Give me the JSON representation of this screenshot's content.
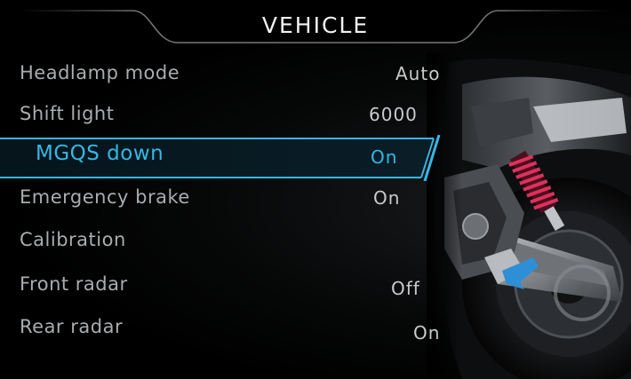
{
  "header": {
    "title": "VEHICLE"
  },
  "menu": {
    "items": [
      {
        "label": "Headlamp mode",
        "value": "Auto"
      },
      {
        "label": "Shift light",
        "value": "6000"
      },
      {
        "label": "MGQS down",
        "value": "On",
        "selected": true
      },
      {
        "label": "Emergency brake",
        "value": "On"
      },
      {
        "label": "Calibration",
        "value": ""
      },
      {
        "label": "Front radar",
        "value": "Off"
      },
      {
        "label": "Rear radar",
        "value": "On"
      }
    ]
  },
  "colors": {
    "accent": "#33b8e6",
    "text": "#a9acaf",
    "background": "#000000",
    "suspension_spring": "#e0305c"
  },
  "icons": {
    "illustration": "motorcycle-rear-illustration"
  }
}
